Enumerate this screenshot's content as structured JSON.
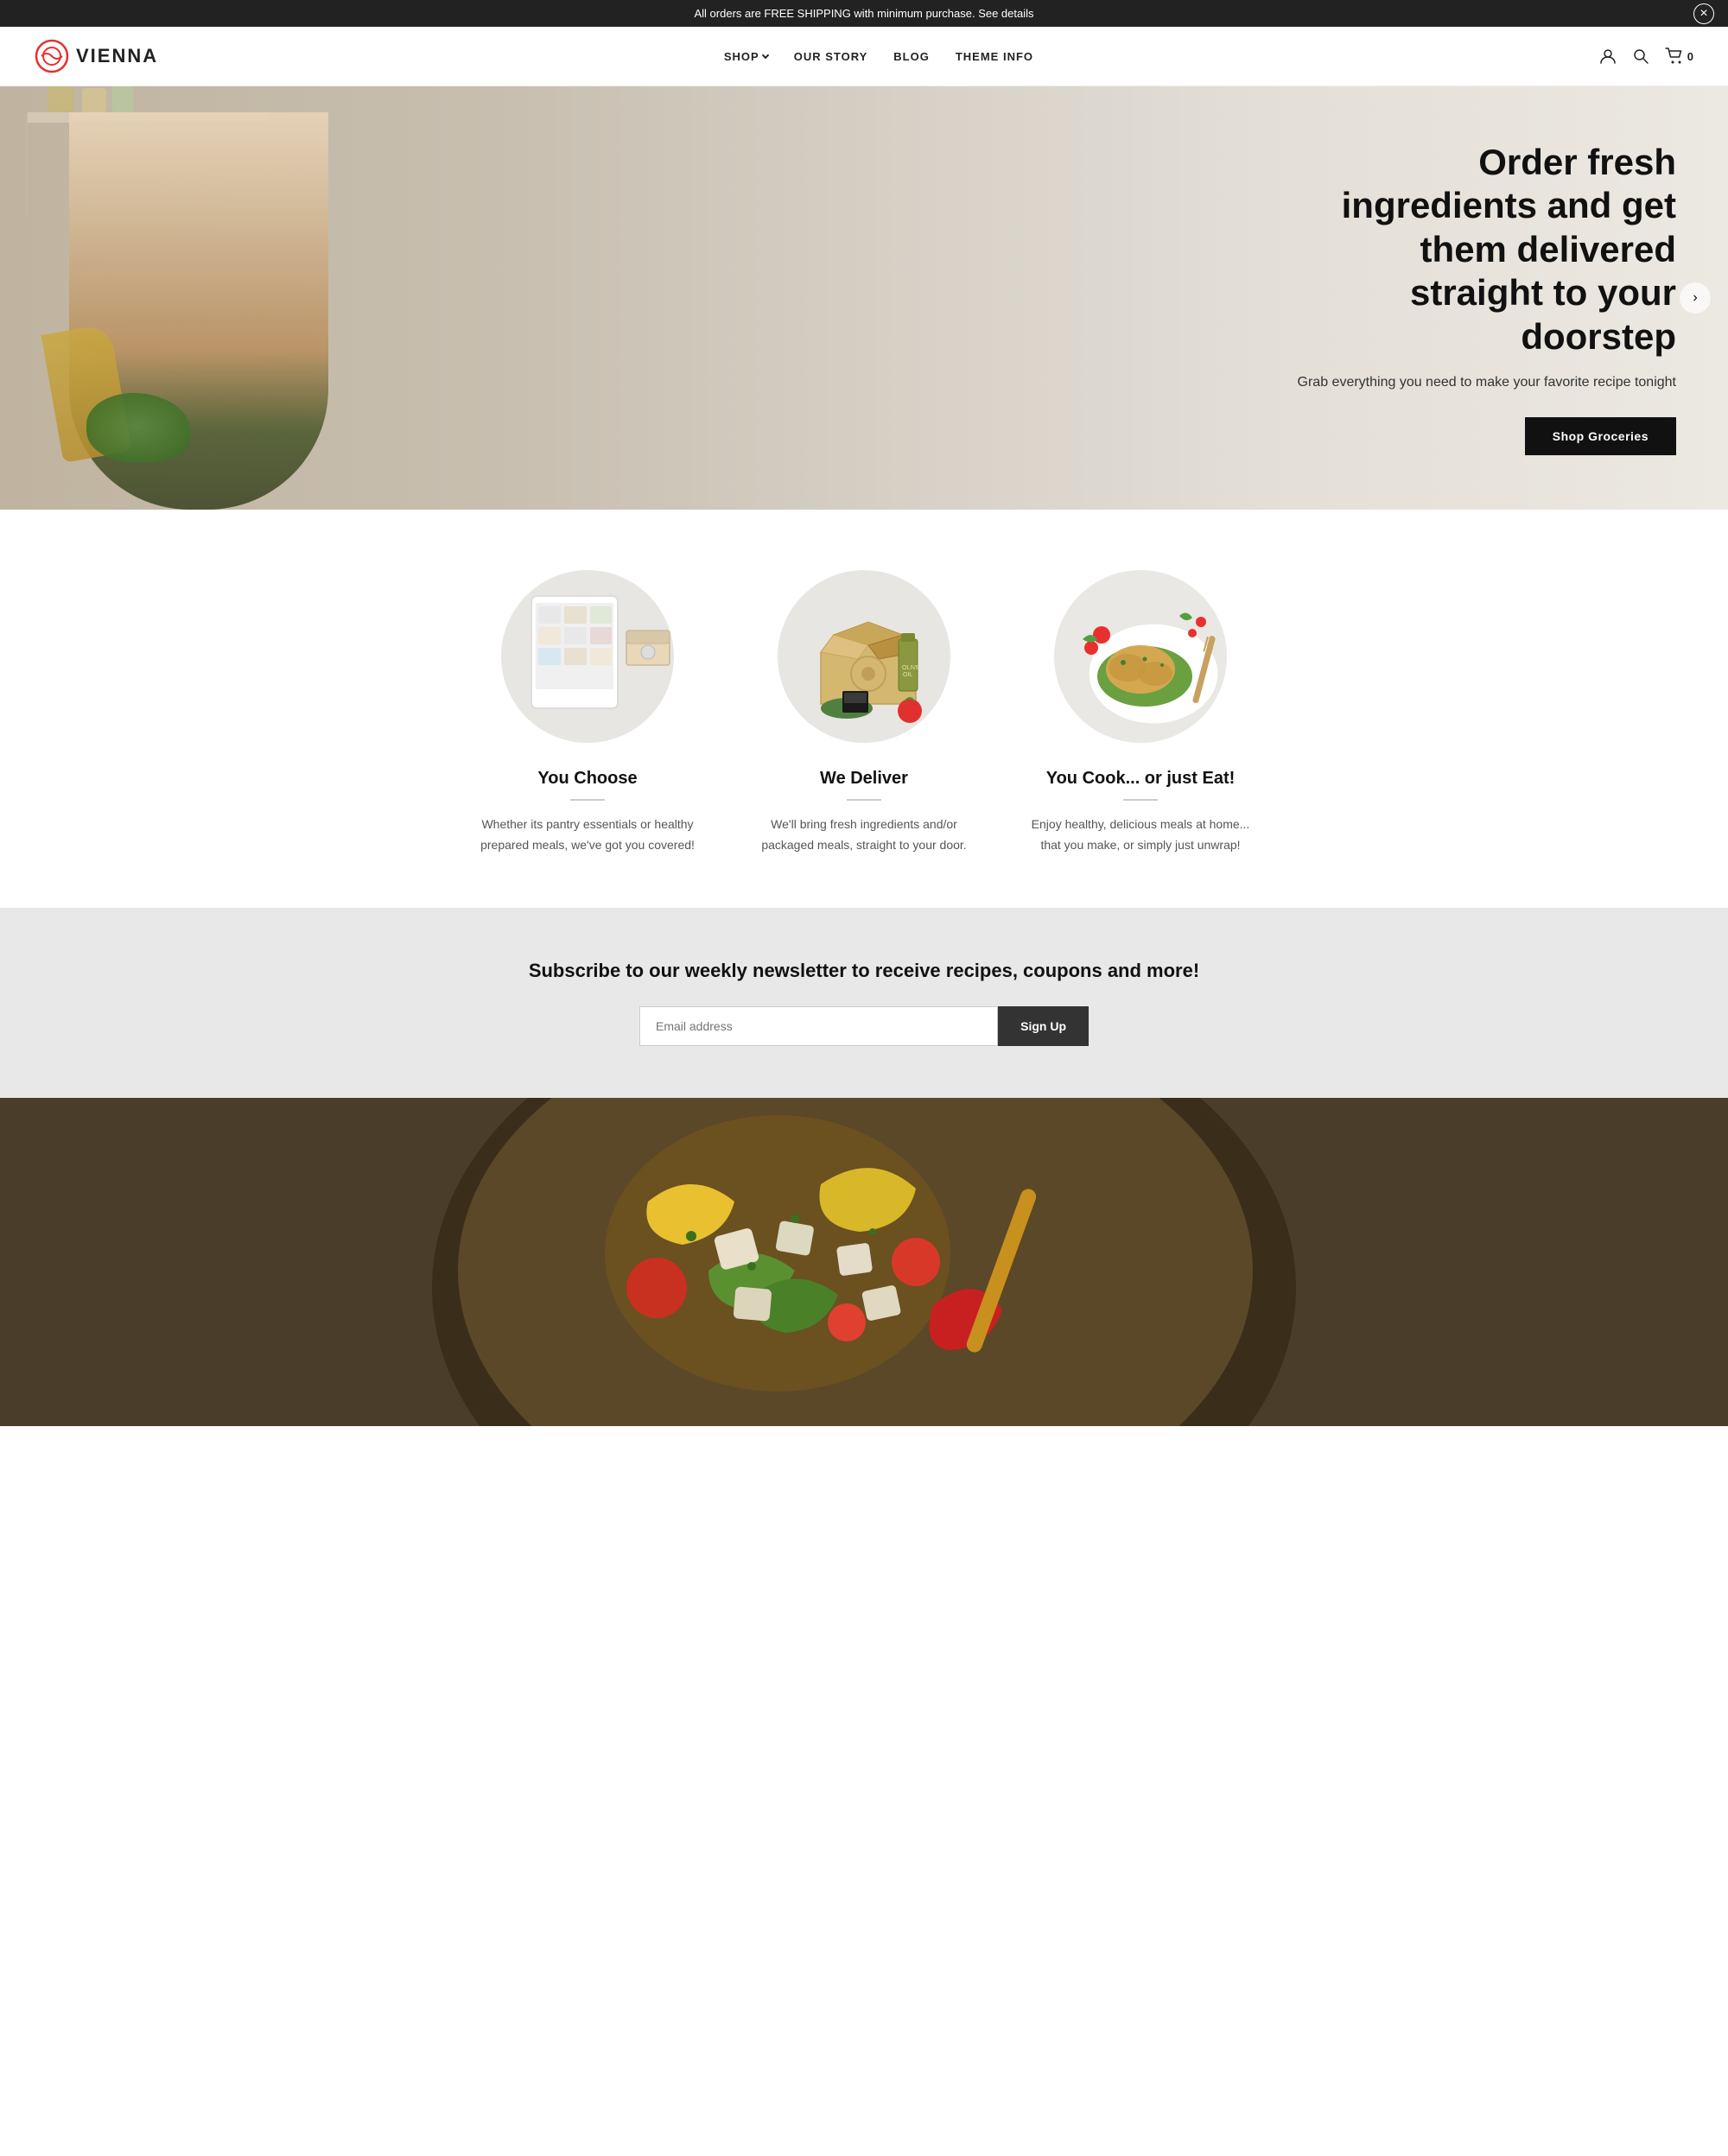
{
  "announcement": {
    "text": "All orders are FREE SHIPPING with minimum purchase. See details",
    "close_label": "×"
  },
  "header": {
    "logo_text": "VIENNA",
    "nav_items": [
      {
        "label": "SHOP",
        "has_dropdown": true
      },
      {
        "label": "OUR STORY",
        "has_dropdown": false
      },
      {
        "label": "BLOG",
        "has_dropdown": false
      },
      {
        "label": "THEME INFO",
        "has_dropdown": false
      }
    ],
    "cart_count": "0"
  },
  "hero": {
    "title": "Order fresh ingredients and get them delivered straight to your doorstep",
    "subtitle": "Grab everything you need to make your favorite recipe tonight",
    "cta_label": "Shop Groceries"
  },
  "features": [
    {
      "title": "You Choose",
      "description": "Whether its pantry essentials or healthy prepared meals, we've got you covered!"
    },
    {
      "title": "We Deliver",
      "description": "We'll bring fresh ingredients and/or packaged meals, straight to your door."
    },
    {
      "title": "You Cook... or just Eat!",
      "description": "Enjoy healthy, delicious meals at home... that you make, or simply just unwrap!"
    }
  ],
  "newsletter": {
    "title": "Subscribe to our weekly newsletter to receive recipes, coupons and more!",
    "input_placeholder": "Email address",
    "button_label": "Sign Up"
  },
  "colors": {
    "primary": "#111111",
    "hero_bg_start": "#b8a898",
    "hero_bg_end": "#e8e2da",
    "feature_circle": "#e8e6e2",
    "newsletter_bg": "#e8e8e8",
    "cta_bg": "#111111",
    "cta_text": "#ffffff"
  }
}
